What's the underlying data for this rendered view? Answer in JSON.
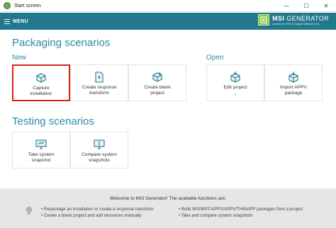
{
  "window": {
    "title": "Start screen",
    "controls": [
      "—",
      "☐",
      "✕"
    ]
  },
  "header": {
    "menu_label": "MENU",
    "brand_name_bold": "MSI",
    "brand_name_rest": " GENERATOR",
    "brand_subtitle": "Licensed for PACE Support (Internal use)"
  },
  "packaging": {
    "title": "Packaging scenarios",
    "new_label": "New",
    "open_label": "Open",
    "new_tiles": [
      {
        "label": "Capture installation",
        "icon": "capture-box-icon",
        "selected": true
      },
      {
        "label": "Create response transform",
        "icon": "response-file-icon",
        "selected": false
      },
      {
        "label": "Create blank project",
        "icon": "blank-box-icon",
        "selected": false
      }
    ],
    "open_tiles": [
      {
        "label": "Edit project",
        "icon": "edit-box-icon",
        "dropdown": "⌄"
      },
      {
        "label": "Import APPV package",
        "icon": "import-package-icon"
      }
    ]
  },
  "testing": {
    "title": "Testing scenarios",
    "tiles": [
      {
        "label": "Take system snapshot",
        "icon": "monitor-snapshot-icon"
      },
      {
        "label": "Compare system snapshots",
        "icon": "monitor-compare-icon"
      }
    ]
  },
  "info": {
    "title": "Welcome to MSI Generator! The available functions are:",
    "icon": "lightbulb-icon",
    "left_items": [
      "Repackage an installation or create a response transform",
      "Create a blank project and add resources manually"
    ],
    "right_items": [
      "Build MSI/MST/APPX/APPV/THINAPP packages from a project",
      "Take and compare system snapshots"
    ]
  },
  "colors": {
    "header_bg": "#22788d",
    "accent_text": "#2a8ba2",
    "selection_border": "#d9221c",
    "info_bg": "#e6e6e6"
  }
}
